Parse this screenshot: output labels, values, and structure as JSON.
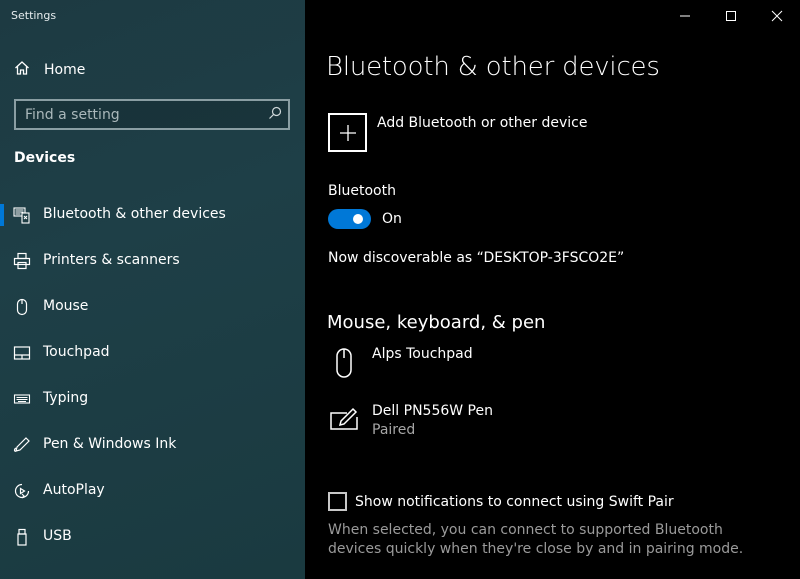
{
  "app": {
    "title": "Settings"
  },
  "window_controls": {
    "minimize": "minimize",
    "maximize": "maximize",
    "close": "close"
  },
  "sidebar": {
    "home_label": "Home",
    "search": {
      "placeholder": "Find a setting",
      "value": ""
    },
    "section_label": "Devices",
    "items": [
      {
        "label": "Bluetooth & other devices",
        "icon": "bluetooth-devices-icon",
        "selected": true
      },
      {
        "label": "Printers & scanners",
        "icon": "printer-icon",
        "selected": false
      },
      {
        "label": "Mouse",
        "icon": "mouse-icon",
        "selected": false
      },
      {
        "label": "Touchpad",
        "icon": "touchpad-icon",
        "selected": false
      },
      {
        "label": "Typing",
        "icon": "keyboard-icon",
        "selected": false
      },
      {
        "label": "Pen & Windows Ink",
        "icon": "pen-icon",
        "selected": false
      },
      {
        "label": "AutoPlay",
        "icon": "autoplay-icon",
        "selected": false
      },
      {
        "label": "USB",
        "icon": "usb-icon",
        "selected": false
      }
    ]
  },
  "main": {
    "title": "Bluetooth & other devices",
    "add_device_label": "Add Bluetooth or other device",
    "bluetooth": {
      "label": "Bluetooth",
      "toggle_on": true,
      "state_label": "On",
      "discoverable_text": "Now discoverable as “DESKTOP-3FSCO2E”"
    },
    "devices_section": {
      "title": "Mouse, keyboard, & pen",
      "devices": [
        {
          "name": "Alps Touchpad",
          "status": "",
          "icon": "mouse-icon"
        },
        {
          "name": "Dell PN556W Pen",
          "status": "Paired",
          "icon": "pen-tablet-icon"
        }
      ]
    },
    "swift_pair": {
      "checked": false,
      "label": "Show notifications to connect using Swift Pair",
      "description": "When selected, you can connect to supported Bluetooth devices quickly when they're close by and in pairing mode."
    }
  },
  "colors": {
    "accent": "#0078d7",
    "sidebar_bg": "#1e3d44",
    "main_bg": "#000000",
    "muted_text": "#9a9a9a"
  }
}
